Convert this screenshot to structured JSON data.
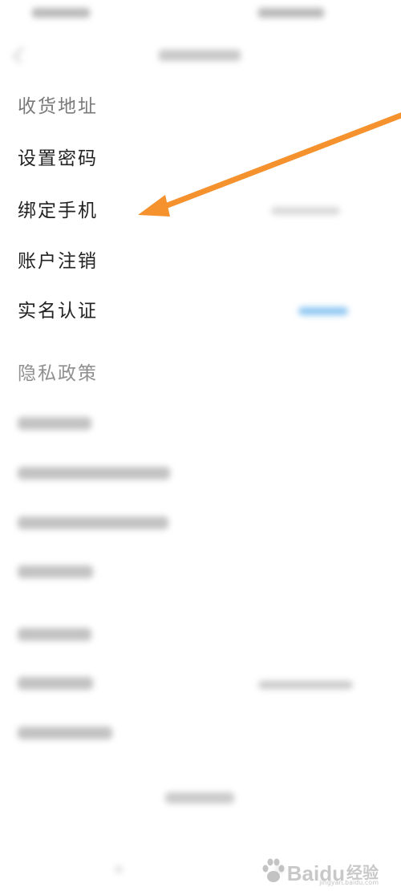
{
  "menu": {
    "shipping_address": "收货地址",
    "set_password": "设置密码",
    "bind_phone": "绑定手机",
    "account_cancel": "账户注销",
    "real_name": "实名认证",
    "privacy_policy": "隐私政策"
  },
  "watermark": {
    "brand_bai": "Bai",
    "brand_du": "du",
    "brand_suffix": "经验",
    "url": "jingyan.baidu.com"
  },
  "colors": {
    "arrow": "#f5922e",
    "accent_blurred_value": "#6fb8f0"
  },
  "icons": {
    "back": "chevron-left-icon",
    "annotation": "arrow-icon",
    "watermark": "paw-icon"
  }
}
